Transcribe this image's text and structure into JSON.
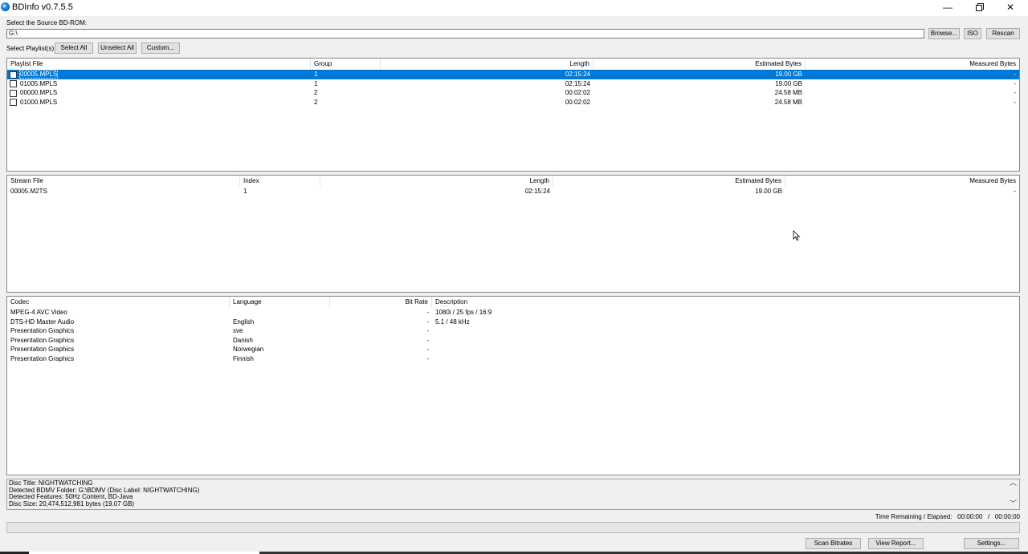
{
  "window": {
    "title": "BDInfo v0.7.5.5",
    "controls": {
      "minimize": "—",
      "close": "✕"
    }
  },
  "source": {
    "label": "Select the Source BD-ROM:",
    "value": "G:\\",
    "browse": "Browse...",
    "iso": "ISO",
    "rescan": "Rescan"
  },
  "playlists_bar": {
    "label": "Select Playlist(s):",
    "select_all": "Select All",
    "unselect_all": "Unselect All",
    "custom": "Custom..."
  },
  "playlist_table": {
    "columns": [
      "Playlist File",
      "Group",
      "Length",
      "Estimated Bytes",
      "Measured Bytes"
    ],
    "rows": [
      {
        "file": "00005.MPLS",
        "group": "1",
        "length": "02:15:24",
        "est": "19.00 GB",
        "meas": "-"
      },
      {
        "file": "01005.MPLS",
        "group": "1",
        "length": "02:15:24",
        "est": "19.00 GB",
        "meas": "-"
      },
      {
        "file": "00000.MPLS",
        "group": "2",
        "length": "00:02:02",
        "est": "24.58 MB",
        "meas": "-"
      },
      {
        "file": "01000.MPLS",
        "group": "2",
        "length": "00:02:02",
        "est": "24.58 MB",
        "meas": "-"
      }
    ]
  },
  "stream_table": {
    "columns": [
      "Stream File",
      "Index",
      "Length",
      "Estimated Bytes",
      "Measured Bytes"
    ],
    "rows": [
      {
        "file": "00005.M2TS",
        "index": "1",
        "length": "02:15:24",
        "est": "19.00 GB",
        "meas": "-"
      }
    ]
  },
  "codec_table": {
    "columns": [
      "Codec",
      "Language",
      "Bit Rate",
      "Description"
    ],
    "rows": [
      {
        "codec": "MPEG-4 AVC Video",
        "lang": "",
        "bitrate": "-",
        "desc": "1080i / 25 fps / 16:9"
      },
      {
        "codec": "DTS-HD Master Audio",
        "lang": "English",
        "bitrate": "-",
        "desc": "5.1 / 48 kHz"
      },
      {
        "codec": "Presentation Graphics",
        "lang": "sve",
        "bitrate": "-",
        "desc": ""
      },
      {
        "codec": "Presentation Graphics",
        "lang": "Danish",
        "bitrate": "-",
        "desc": ""
      },
      {
        "codec": "Presentation Graphics",
        "lang": "Norwegian",
        "bitrate": "-",
        "desc": ""
      },
      {
        "codec": "Presentation Graphics",
        "lang": "Finnish",
        "bitrate": "-",
        "desc": ""
      }
    ]
  },
  "info": {
    "lines": [
      "Disc Title: NIGHTWATCHING",
      "Detected BDMV Folder: G:\\BDMV (Disc Label: NIGHTWATCHING)",
      "Detected Features: 50Hz Content, BD-Java",
      "Disc Size: 20,474,512,981 bytes (19.07 GB)"
    ]
  },
  "time": {
    "label": "Time Remaining / Elapsed:",
    "remaining": "00:00:00",
    "separator": "/",
    "elapsed": "00:00:00"
  },
  "bottom_buttons": {
    "scan": "Scan Bitrates",
    "report": "View Report...",
    "settings": "Settings..."
  }
}
